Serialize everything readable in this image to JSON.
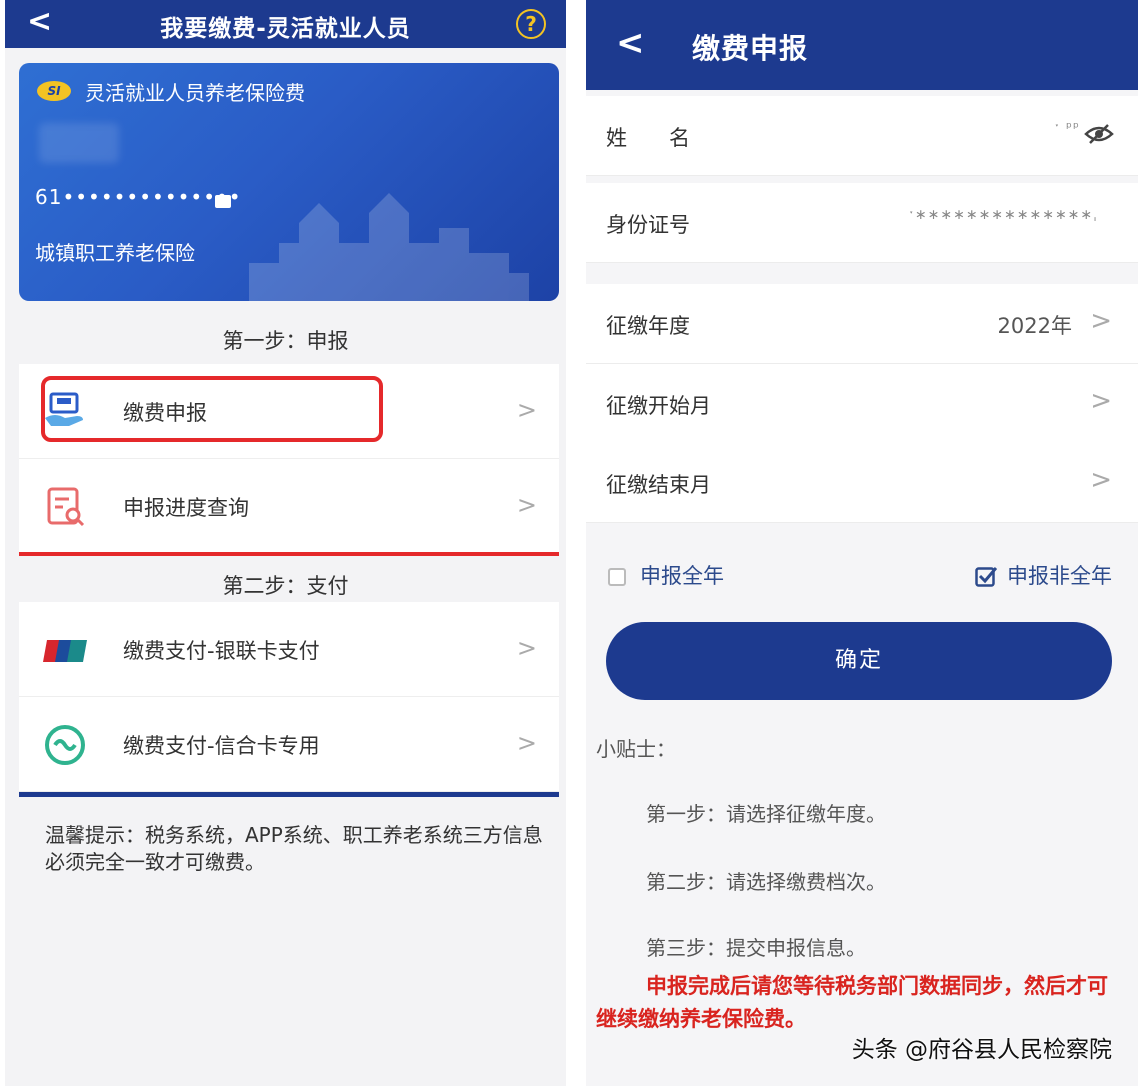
{
  "left": {
    "header": {
      "back": "<",
      "title": "我要缴费-灵活就业人员",
      "help": "?"
    },
    "card": {
      "logo": "SI",
      "title": "灵活就业人员养老保险费",
      "id_number": "61••••••••••••••",
      "insurance_type": "城镇职工养老保险"
    },
    "step1": "第一步：申报",
    "step1_items": [
      {
        "label": "缴费申报",
        "icon": "payment-declare-icon"
      },
      {
        "label": "申报进度查询",
        "icon": "document-search-icon"
      }
    ],
    "step2": "第二步：支付",
    "step2_items": [
      {
        "label": "缴费支付-银联卡支付",
        "icon": "unionpay-icon"
      },
      {
        "label": "缴费支付-信合卡专用",
        "icon": "rural-credit-icon"
      }
    ],
    "tip": "温馨提示：税务系统，APP系统、职工养老系统三方信息必须完全一致才可缴费。",
    "chevron": ">",
    "colors": {
      "header": "#1d3a8f",
      "highlight": "#e5292b"
    }
  },
  "right": {
    "header": {
      "back": "<",
      "title": "缴费申报"
    },
    "fields": {
      "name": {
        "label": "姓　　名",
        "value": "ˑ ᵖᵖ"
      },
      "id": {
        "label": "身份证号",
        "value": "ˑ∗∗∗∗∗∗∗∗∗∗∗∗∗∗ˌ"
      },
      "year": {
        "label": "征缴年度",
        "value": "2022年"
      },
      "start": {
        "label": "征缴开始月",
        "value": ""
      },
      "end": {
        "label": "征缴结束月",
        "value": ""
      }
    },
    "options": {
      "full_year": "申报全年",
      "partial_year": "申报非全年",
      "partial_checked": true
    },
    "confirm": "确定",
    "tips": {
      "title": "小贴士：",
      "step1": "第一步：请选择征缴年度。",
      "step2": "第二步：请选择缴费档次。",
      "step3": "第三步：提交申报信息。",
      "notice": "申报完成后请您等待税务部门数据同步，然后才可继续缴纳养老保险费。"
    },
    "watermark": "头条 @府谷县人民检察院",
    "chevron": ">"
  }
}
